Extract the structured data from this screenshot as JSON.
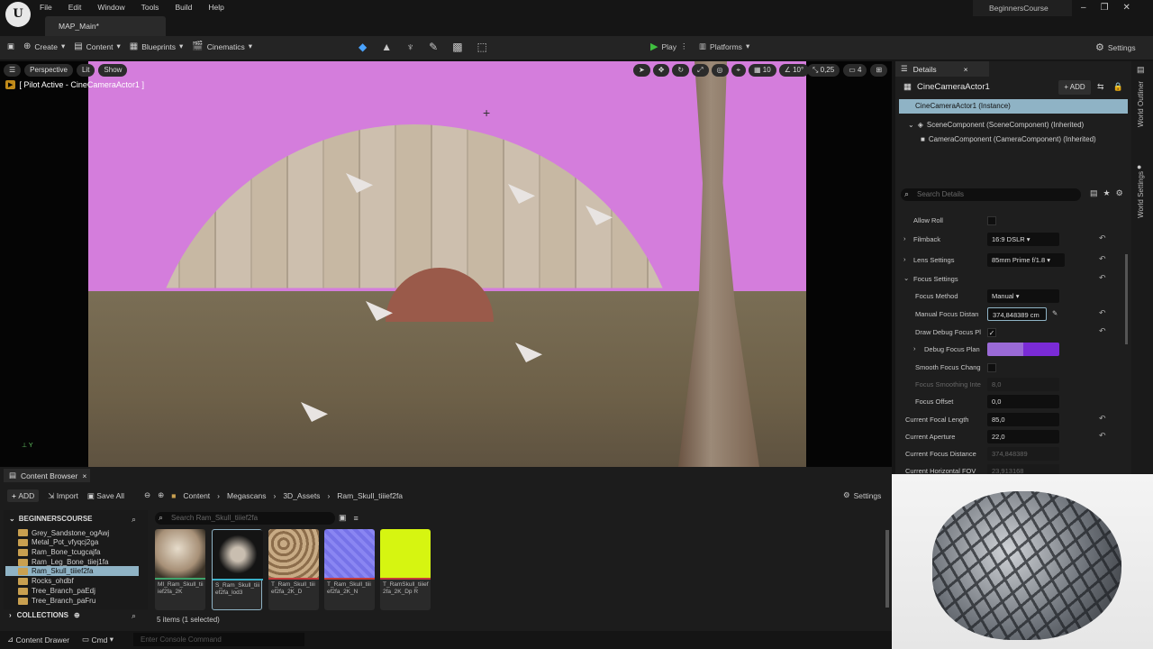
{
  "menu": {
    "items": [
      "File",
      "Edit",
      "Window",
      "Tools",
      "Build",
      "Help"
    ],
    "project": "BeginnersCourse"
  },
  "tabs": {
    "map": "MAP_Main*"
  },
  "toolbar": {
    "create": "Create",
    "content": "Content",
    "blueprints": "Blueprints",
    "cinematics": "Cinematics",
    "play": "Play",
    "platforms": "Platforms",
    "settings": "Settings"
  },
  "viewport": {
    "perspective": "Perspective",
    "lit": "Lit",
    "show": "Show",
    "pilot": "[ Pilot Active - CineCameraActor1 ]",
    "grid": "10",
    "angle": "10°",
    "scale": "0,25",
    "cams": "4"
  },
  "details": {
    "tab": "Details",
    "actor": "CineCameraActor1",
    "add": "+ ADD",
    "selected": "CineCameraActor1 (Instance)",
    "comp1": "SceneComponent (SceneComponent) (Inherited)",
    "comp2": "CameraComponent (CameraComponent) (Inherited)",
    "search_placeholder": "Search Details",
    "props": {
      "allow_roll": "Allow Roll",
      "filmback": "Filmback",
      "filmback_val": "16:9 DSLR",
      "lens": "Lens Settings",
      "lens_val": "85mm Prime f/1.8",
      "focus": "Focus Settings",
      "focus_method": "Focus Method",
      "focus_method_val": "Manual",
      "manual_focus": "Manual Focus Distan",
      "manual_focus_val": "374,848389 cm",
      "draw_debug": "Draw Debug Focus Pl",
      "debug_plane": "Debug Focus Plan",
      "smooth": "Smooth Focus Chang",
      "smooth_int": "Focus Smoothing Inte",
      "smooth_int_val": "8,0",
      "offset": "Focus Offset",
      "offset_val": "0,0",
      "cur_focal": "Current Focal Length",
      "cur_focal_val": "85,0",
      "cur_aperture": "Current Aperture",
      "cur_aperture_val": "22,0",
      "cur_focus_dist": "Current Focus Distance",
      "cur_focus_dist_val": "374,848389",
      "cur_hfov": "Current Horizontal FOV",
      "cur_hfov_val": "23,913168"
    }
  },
  "right_strip": {
    "outliner": "World Outliner",
    "settings": "World Settings"
  },
  "content_browser": {
    "tab": "Content Browser",
    "add": "ADD",
    "import": "Import",
    "save_all": "Save All",
    "crumbs": [
      "Content",
      "Megascans",
      "3D_Assets",
      "Ram_Skull_tiiief2fa"
    ],
    "settings": "Settings",
    "tree_root": "BEGINNERSCOURSE",
    "folders": [
      "Grey_Sandstone_ogAwj",
      "Metal_Pot_vfyqcj2ga",
      "Ram_Bone_tcugcajfa",
      "Ram_Leg_Bone_tiiej1fa",
      "Ram_Skull_tiiief2fa",
      "Rocks_ohdbf",
      "Tree_Branch_paEdj",
      "Tree_Branch_paFru"
    ],
    "collections": "COLLECTIONS",
    "search_placeholder": "Search Ram_Skull_tiiief2fa",
    "assets": [
      {
        "name": "MI_Ram_Skull_tiiief2fa_2K"
      },
      {
        "name": "S_Ram_Skull_tiiief2fa_lod3"
      },
      {
        "name": "T_Ram_Skull_tiiief2fa_2K_D"
      },
      {
        "name": "T_Ram_Skull_tiiief2fa_2K_N"
      },
      {
        "name": "T_RamSkull_tiiief2fa_2K_Dp R"
      }
    ],
    "items": "5 items (1 selected)"
  },
  "status": {
    "drawer": "Content Drawer",
    "cmd": "Cmd",
    "console_placeholder": "Enter Console Command"
  },
  "colors": {
    "accent": "#8fb3c5",
    "sky": "#d47ddc",
    "play": "#3fbf3f",
    "debug_plane": "#7a2bd6"
  }
}
